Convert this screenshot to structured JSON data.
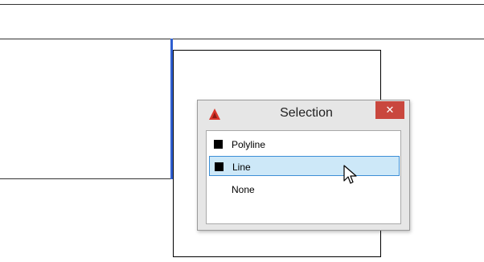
{
  "dialog": {
    "title": "Selection",
    "close_label": "✕",
    "items": [
      {
        "label": "Polyline",
        "swatch_color": "#000000",
        "selected": false
      },
      {
        "label": "Line",
        "swatch_color": "#000000",
        "selected": true
      },
      {
        "label": "None",
        "swatch_color": null,
        "selected": false
      }
    ]
  },
  "colors": {
    "selection_highlight": "#cde8f8",
    "selection_border": "#3d8fd6",
    "close_button": "#c9473e",
    "selected_geometry": "#2f5fd0",
    "app_logo": "#d9352b"
  },
  "icons": {
    "app": "autocad-logo-icon",
    "close": "close-icon",
    "pointer": "mouse-pointer-icon"
  }
}
